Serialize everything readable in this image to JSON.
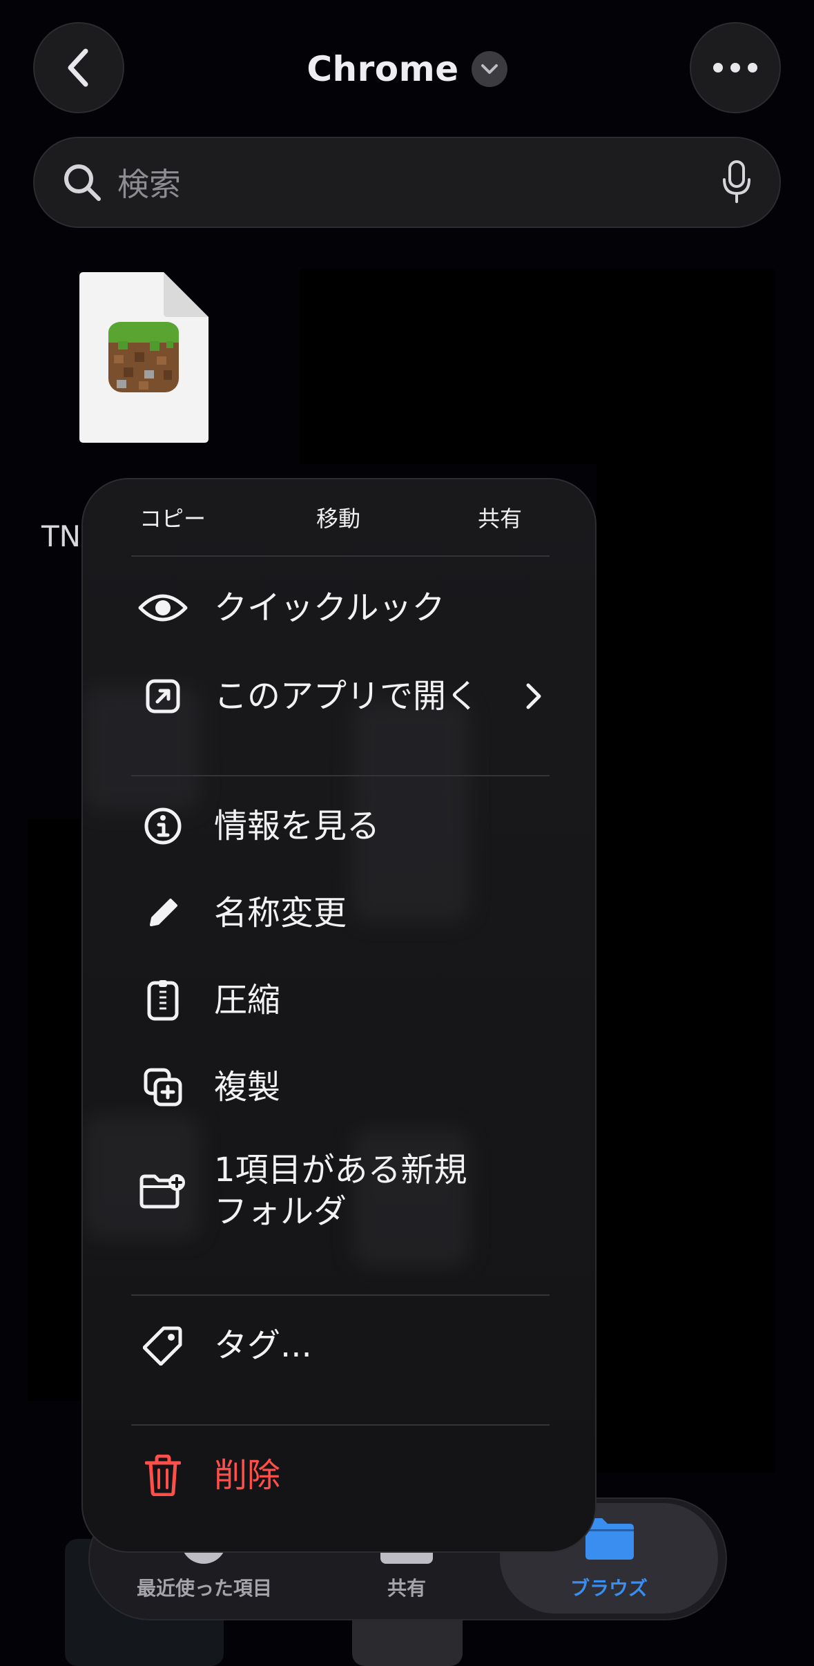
{
  "header": {
    "title": "Chrome",
    "back_icon": "chevron-left-icon",
    "title_menu_icon": "chevron-down-icon",
    "more_icon": "ellipsis-icon"
  },
  "search": {
    "placeholder": "検索",
    "search_icon": "magnifier-icon",
    "mic_icon": "microphone-icon"
  },
  "file": {
    "name_visible": "TN",
    "thumbnail_icon": "minecraft-grass-block-icon"
  },
  "context_menu": {
    "top_actions": [
      "コピー",
      "移動",
      "共有"
    ],
    "items": [
      {
        "label": "クイックルック",
        "icon": "eye-icon"
      },
      {
        "label": "このアプリで開く",
        "icon": "open-external-icon",
        "has_submenu": true
      },
      {
        "label": "情報を見る",
        "icon": "info-circle-icon"
      },
      {
        "label": "名称変更",
        "icon": "pencil-icon"
      },
      {
        "label": "圧縮",
        "icon": "zip-archive-icon"
      },
      {
        "label": "複製",
        "icon": "duplicate-icon"
      },
      {
        "label": "1項目がある新規",
        "label_line2": "フォルダ",
        "icon": "folder-plus-icon"
      },
      {
        "label": "タグ...",
        "icon": "tag-icon"
      },
      {
        "label": "削除",
        "icon": "trash-icon",
        "destructive": true
      }
    ],
    "destructive_color": "#ff4f4a"
  },
  "tabbar": {
    "tabs": [
      {
        "label": "最近使った項目",
        "icon": "clock-icon",
        "active": false
      },
      {
        "label": "共有",
        "icon": "shared-folder-icon",
        "active": false
      },
      {
        "label": "ブラウズ",
        "icon": "folder-icon",
        "active": true
      }
    ],
    "accent_color": "#3a8ef0"
  }
}
